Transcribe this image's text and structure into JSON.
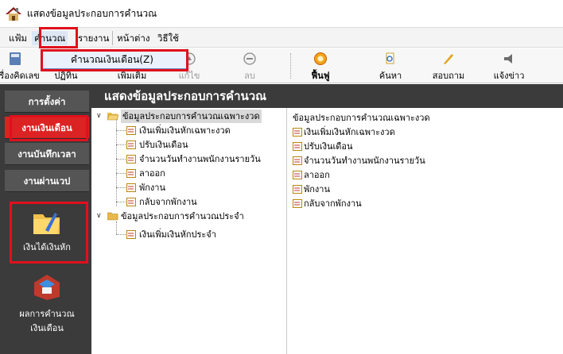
{
  "window": {
    "title": "แสดงข้อมูลประกอบการคำนวณ",
    "app_icon": "house-roof-icon"
  },
  "menubar": {
    "items": [
      {
        "label": "แฟ้ม"
      },
      {
        "label": "คำนวณ"
      },
      {
        "label": "รายงาน"
      },
      {
        "label": "หน้าต่าง"
      },
      {
        "label": "วิธีใช้"
      }
    ],
    "active_item": "คำนวณ"
  },
  "dropdown": {
    "item_label": "คำนวณเงินเดือน(Z)"
  },
  "toolbar": {
    "buttons": [
      {
        "label": "เครื่องคิดเลข",
        "icon": "calculator-icon",
        "enabled": true
      },
      {
        "label": "ปฏิทิน",
        "icon": "calendar-icon",
        "enabled": true
      },
      {
        "label": "เพิ่มเติม",
        "icon": "add-icon",
        "enabled": true
      },
      {
        "label": "แก้ไข",
        "icon": "edit-icon",
        "enabled": false
      },
      {
        "label": "ลบ",
        "icon": "delete-icon",
        "enabled": false
      },
      {
        "label": "ฟื้นฟู",
        "icon": "refresh-icon",
        "enabled": true
      },
      {
        "label": "ค้นหา",
        "icon": "find-icon",
        "enabled": true
      },
      {
        "label": "สอบถาม",
        "icon": "inquiry-icon",
        "enabled": true
      },
      {
        "label": "แจ้งข่าว",
        "icon": "announce-icon",
        "enabled": true
      }
    ]
  },
  "leftnav": {
    "tabs": [
      {
        "label": "การตั้งค่า",
        "active": false
      },
      {
        "label": "งานเงินเดือน",
        "active": true
      },
      {
        "label": "งานบันทึกเวลา",
        "active": false
      },
      {
        "label": "งานผ่านเวป",
        "active": false
      }
    ],
    "shortcuts": [
      {
        "label": "เงินได้เงินหัก",
        "icon": "folder-edit-icon",
        "highlighted": true
      },
      {
        "label_line1": "ผลการคำนวณ",
        "label_line2": "เงินเดือน",
        "icon": "payroll-result-icon",
        "highlighted": false
      }
    ]
  },
  "content": {
    "header": "แสดงข้อมูลประกอบการคำนวณ",
    "tree": {
      "groups": [
        {
          "label": "ข้อมูลประกอบการคำนวณเฉพาะงวด",
          "expanded": true,
          "selected": true,
          "children": [
            "เงินเพิ่มเงินหักเฉพาะงวด",
            "ปรับเงินเดือน",
            "จำนวนวันทำงานพนักงานรายวัน",
            "ลาออก",
            "พักงาน",
            "กลับจากพักงาน"
          ]
        },
        {
          "label": "ข้อมูลประกอบการคำนวณประจำ",
          "expanded": true,
          "selected": false,
          "children": [
            "เงินเพิ่มเงินหักประจำ"
          ]
        }
      ]
    },
    "list": {
      "header": "ข้อมูลประกอบการคำนวณเฉพาะงวด",
      "items": [
        "เงินเพิ่มเงินหักเฉพาะงวด",
        "ปรับเงินเดือน",
        "จำนวนวันทำงานพนักงานรายวัน",
        "ลาออก",
        "พักงาน",
        "กลับจากพักงาน"
      ]
    }
  },
  "colors": {
    "highlight_red": "#e0101c",
    "nav_bg": "#3b3b3b",
    "active_tab": "#dc2323",
    "selection_bg": "#d9d9d9",
    "dropdown_bg": "#eaf1fb"
  }
}
